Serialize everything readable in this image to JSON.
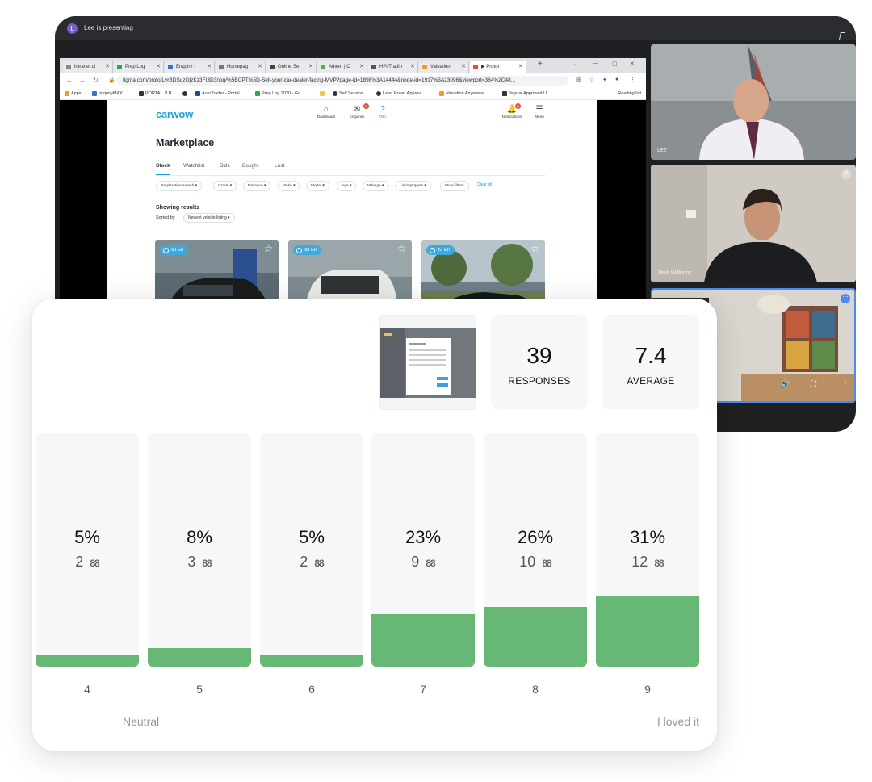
{
  "call": {
    "presenter_initial": "L",
    "presenter_text": "Lee is presenting"
  },
  "browser": {
    "tabs": [
      {
        "label": "intranet.cl",
        "color": "#8a8a8a"
      },
      {
        "label": "Prep Log",
        "color": "#2aa84a"
      },
      {
        "label": "Enquiry -",
        "color": "#3b6fd1"
      },
      {
        "label": "Homepag",
        "color": "#777777"
      },
      {
        "label": "Online Se",
        "color": "#444444"
      },
      {
        "label": "Advert | C",
        "color": "#4caf50"
      },
      {
        "label": "HPi Tradin",
        "color": "#555555"
      },
      {
        "label": "Valuation",
        "color": "#f0a020"
      },
      {
        "label": "▶ Protot",
        "color": "#e84b3c"
      }
    ],
    "url": "figma.com/proto/LvrBDSuzOjzKz3FI3D3noq/%5BCPT%5D-Sell-your-car-dealer-facing-MVP?page-id=1898%3A14444&node-id=1917%3A23096&viewport=384%2C48...",
    "bookmarks": [
      {
        "label": "Apps",
        "color": "#e0a02a"
      },
      {
        "label": "enquiryMAX",
        "color": "#3b6fd1"
      },
      {
        "label": "PORTAL JLR",
        "color": "#333333"
      },
      {
        "label": "",
        "color": "#333333"
      },
      {
        "label": "AutoTrader - Portal",
        "color": "#1e4a8a"
      },
      {
        "label": "Prep Log 2020 - Go...",
        "color": "#2aa84a"
      },
      {
        "label": "",
        "color": "#f2c94c"
      },
      {
        "label": "Self Service",
        "color": "#333333"
      },
      {
        "label": "Land Rover Approv...",
        "color": "#333333"
      },
      {
        "label": "Valuation Anywhere",
        "color": "#f0a020"
      },
      {
        "label": "Jaguar Approved U...",
        "color": "#333333"
      }
    ],
    "reading_list": "Reading list"
  },
  "carwow": {
    "logo": "carwow",
    "nav": [
      {
        "label": "Dashboard",
        "icon": "home-icon",
        "glyph": "⌂"
      },
      {
        "label": "Enquiries",
        "icon": "mail-icon",
        "glyph": "✉",
        "badge": "4"
      },
      {
        "label": "TBC",
        "icon": "question-icon",
        "glyph": "?"
      }
    ],
    "notifications": {
      "label": "Notifications",
      "glyph": "🔔",
      "badge": "6"
    },
    "menu": {
      "label": "Menu",
      "glyph": "☰"
    },
    "title": "Marketplace",
    "tabs": [
      "Stock",
      "Watchlist",
      "Bids",
      "Bought",
      "Lost"
    ],
    "filters": [
      "Registration search ▾",
      "Grade ▾",
      "Distance ▾",
      "Make ▾",
      "Model ▾",
      "Age ▾",
      "Mileage ▾",
      "Listings types ▾",
      "More filters"
    ],
    "clear_all": "Clear all",
    "showing": "Showing results",
    "sorted_by": "Sorted by",
    "sort_value": "Newest vehicle listing ▾",
    "cars": [
      {
        "badge": "3d left"
      },
      {
        "badge": "3d left"
      },
      {
        "badge": "2d left"
      }
    ]
  },
  "participants": [
    {
      "name": "Lee"
    },
    {
      "name": "Jake Williams"
    },
    {
      "name": ""
    }
  ],
  "results": {
    "responses": {
      "value": "39",
      "label": "RESPONSES"
    },
    "average": {
      "value": "7.4",
      "label": "AVERAGE"
    },
    "low_label": "Neutral",
    "high_label": "I loved it"
  },
  "chart_data": {
    "type": "bar",
    "categories": [
      "4",
      "5",
      "6",
      "7",
      "8",
      "9"
    ],
    "values": [
      5,
      8,
      5,
      23,
      26,
      31
    ],
    "percent_labels": [
      "5%",
      "8%",
      "5%",
      "23%",
      "26%",
      "31%"
    ],
    "counts": [
      "2",
      "3",
      "2",
      "9",
      "10",
      "12"
    ],
    "title": "",
    "xlabel": "",
    "ylabel": "",
    "ylim": [
      0,
      100
    ],
    "grid": false,
    "legend": "none",
    "colors": {
      "bar": "#67b775",
      "track": "#f6f7f9"
    }
  }
}
